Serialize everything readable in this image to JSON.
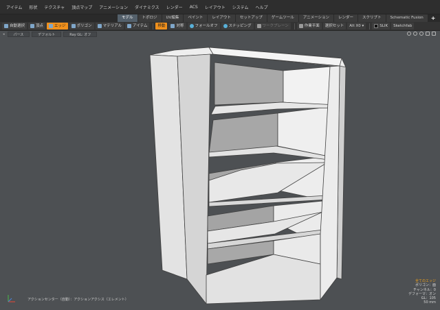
{
  "menubar": {
    "items": [
      "アイテム",
      "形状",
      "テクスチャ",
      "頂点マップ",
      "アニメーション",
      "ダイナミクス",
      "レンダー",
      "ACS",
      "レイアウト",
      "システム",
      "ヘルプ"
    ]
  },
  "layout_tabs": {
    "items": [
      "モデル",
      "トポロジ",
      "UV編集",
      "ペイント",
      "レイアウト",
      "セットアップ",
      "ゲームツール",
      "アニメーション",
      "レンダー",
      "スクリプト",
      "Schematic Fusion"
    ],
    "active": "モデル",
    "add_label": "+"
  },
  "toolbar": {
    "items": [
      {
        "label": "自動選択",
        "icon": "auto-select-icon",
        "active": false
      },
      {
        "label": "頂点",
        "icon": "vertex-icon",
        "active": false
      },
      {
        "label": "エッジ",
        "icon": "edge-icon",
        "active": true
      },
      {
        "label": "ポリゴン",
        "icon": "polygon-icon",
        "active": false
      },
      {
        "label": "マテリアル",
        "icon": "material-icon",
        "active": false
      },
      {
        "label": "アイテム",
        "icon": "item-icon",
        "active": false
      },
      {
        "label": "移動",
        "icon": "",
        "active": true
      },
      {
        "label": "対称",
        "icon": "symmetry-icon",
        "active": false
      },
      {
        "label": "フォールオフ",
        "icon": "falloff-icon",
        "active": false
      },
      {
        "label": "スナッピング",
        "icon": "snapping-icon",
        "active": false
      },
      {
        "label": "ワークプレーン",
        "icon": "workplane-icon",
        "active": false,
        "dim": true
      },
      {
        "label": "作業平面",
        "icon": "work-plane-icon",
        "active": false
      },
      {
        "label": "選択セット",
        "icon": "",
        "active": false
      },
      {
        "label": "Alt X0 ▾",
        "icon": "",
        "active": false
      },
      {
        "label": "SLIK",
        "icon": "slik-icon",
        "active": false
      },
      {
        "label": "Sketchfab",
        "icon": "",
        "active": false
      }
    ]
  },
  "viewport": {
    "header_buttons": [
      "パース",
      "デフォルト",
      "Ray GL: オフ"
    ],
    "background": "#4d5053"
  },
  "info_panel": {
    "lines": [
      "全てのエッジ",
      "ポリゴン：面",
      "チャンネル：0",
      "デフォーマ：オン",
      "GL：105",
      "50 mm"
    ]
  },
  "status_bar": {
    "text": "アクションセンター（自動）：アクションアクシス（エレメント）"
  },
  "colors": {
    "accent": "#f0901c",
    "active_tab": "#54606b",
    "info_highlight": "#f0a21c",
    "viewport_bg": "#4d5053",
    "model_light": "#e4e4e4",
    "model_shade": "#a9a9a9"
  }
}
